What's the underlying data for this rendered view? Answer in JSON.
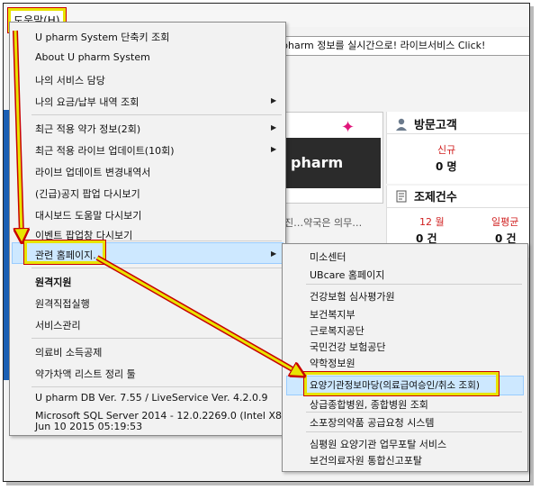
{
  "app": {
    "menu_help": "도움말(H)",
    "live_banner": "pharm 정보를 실시간으로! 라이브서비스 Click!",
    "ad_brand": "pharm",
    "notice_text": "진…약국은 의무…"
  },
  "visit_panel": {
    "title": "방문고객",
    "new_label": "신규",
    "new_value": "0 명"
  },
  "rx_panel": {
    "title": "조제건수",
    "month_label": "12 월",
    "month_value": "0 건",
    "daily_avg_label": "일평균",
    "daily_avg_value": "0 건"
  },
  "help_menu": {
    "items": [
      {
        "label": "U pharm System 단축키 조회"
      },
      {
        "label": "About U pharm System"
      },
      {
        "label": "나의 서비스 담당"
      },
      {
        "label": "나의 요금/납부 내역 조회"
      },
      {
        "label": "최근 적용 약가 정보(2회)"
      },
      {
        "label": "최근 적용 라이브 업데이트(10회)"
      },
      {
        "label": "라이브 업데이트 변경내역서"
      },
      {
        "label": "(긴급)공지 팝업 다시보기"
      },
      {
        "label": "대시보드 도움말 다시보기"
      },
      {
        "label": "이벤트 팝업창 다시보기"
      },
      {
        "label": "관련 홈페이지..."
      },
      {
        "label": "원격지원"
      },
      {
        "label": "원격직접실행"
      },
      {
        "label": "서비스관리"
      },
      {
        "label": "의료비 소득공제"
      },
      {
        "label": "약가차액 리스트 정리 툴"
      }
    ],
    "version_line1": "U pharm DB Ver. 7.55 / LiveService Ver. 4.2.0.9",
    "version_line2": "Microsoft SQL Server 2014 - 12.0.2269.0 (Intel X86)",
    "version_line3": "Jun 10 2015 05:19:53"
  },
  "related_submenu": {
    "items": [
      {
        "label": "미소센터"
      },
      {
        "label": "UBcare 홈페이지"
      },
      {
        "label": "건강보험 심사평가원"
      },
      {
        "label": "보건복지부"
      },
      {
        "label": "근로복지공단"
      },
      {
        "label": "국민건강 보험공단"
      },
      {
        "label": "약학정보원"
      },
      {
        "label": "요양기관정보마당(의료급여승인/취소 조회)"
      },
      {
        "label": "상급종합병원, 종합병원 조회"
      },
      {
        "label": "소포장의약품 공급요청 시스템"
      },
      {
        "label": "심평원 요양기관 업무포탈 서비스"
      },
      {
        "label": "보건의료자원 통합신고포탈"
      }
    ]
  },
  "colors": {
    "highlight_yellow": "#e8e400",
    "highlight_red": "#c80000",
    "selection_blue": "#cde8ff",
    "arrow_red": "#d40000"
  }
}
